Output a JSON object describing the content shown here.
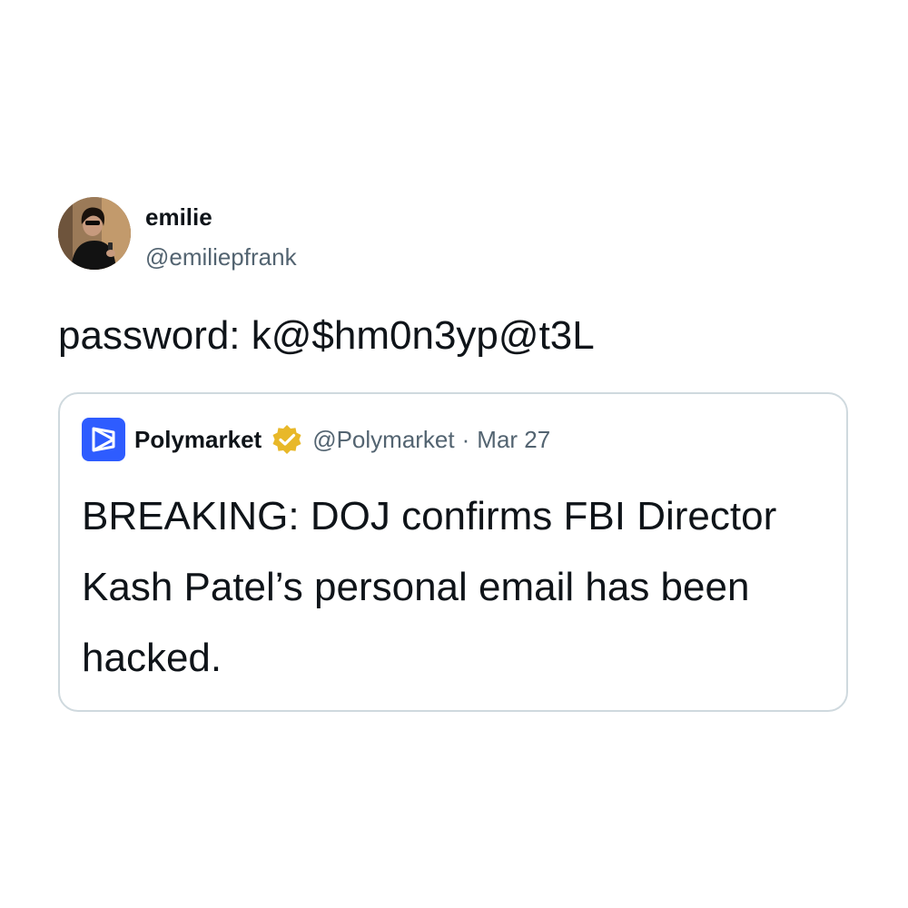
{
  "author": {
    "display_name": "emilie",
    "handle": "@emiliepfrank",
    "avatar_icon": "profile-photo"
  },
  "tweet": {
    "text": "password: k@$hm0n3yp@t3L"
  },
  "quoted_tweet": {
    "display_name": "Polymarket",
    "handle": "@Polymarket",
    "separator": "·",
    "date": "Mar 27",
    "verified": true,
    "logo_icon": "polymarket-logo",
    "verified_icon": "verified-badge-icon",
    "text": "BREAKING: DOJ confirms FBI Director Kash Patel’s personal email has been hacked."
  },
  "colors": {
    "primary_text": "#0f1419",
    "secondary_text": "#536471",
    "border": "#cfd9de",
    "polymarket_blue": "#2e5cff",
    "verified_gold": "#e8b829"
  }
}
